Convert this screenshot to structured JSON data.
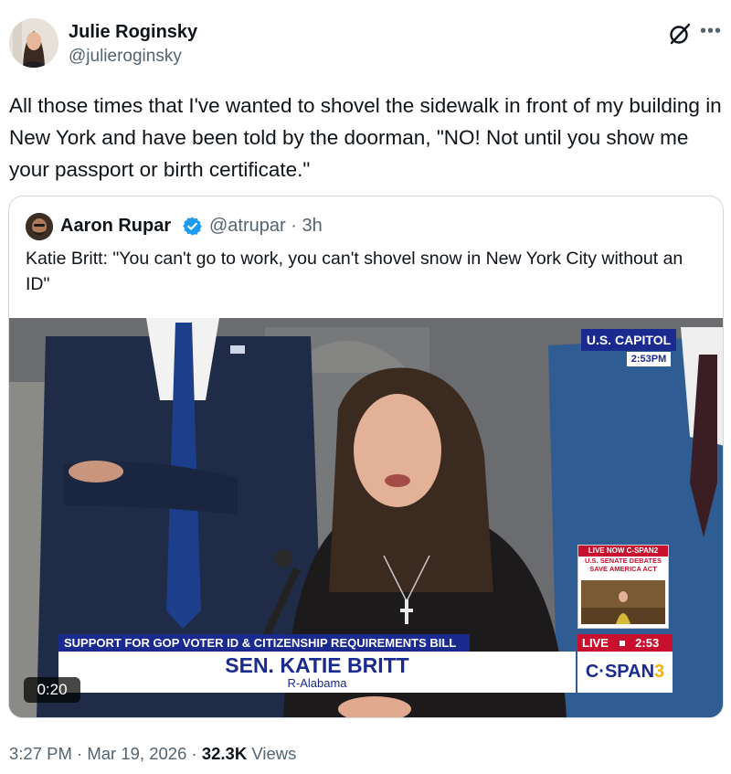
{
  "tweet": {
    "author_name": "Julie Roginsky",
    "author_handle": "@julieroginsky",
    "text": "All those times that I've wanted to shovel the sidewalk in front of my building in New York and have been told by the doorman, \"NO! Not until you show me your passport or birth certificate.\"",
    "time": "3:27 PM",
    "date": "Mar 19, 2026",
    "views_count": "32.3K",
    "views_label": "Views",
    "dot": "·"
  },
  "quoted": {
    "author_name": "Aaron Rupar",
    "author_handle": "@atrupar · 3h",
    "text": "Katie Britt: \"You can't go to work, you can't shovel snow in New York City without an ID\"",
    "video": {
      "duration": "0:20",
      "location_label": "U.S. CAPITOL",
      "location_time": "2:53PM",
      "banner": "SUPPORT FOR GOP VOTER ID & CITIZENSHIP REQUIREMENTS BILL",
      "speaker_name": "SEN. KATIE BRITT",
      "speaker_party": "R-Alabama",
      "inset_header": "LIVE NOW C-SPAN2",
      "inset_line1": "U.S. SENATE DEBATES",
      "inset_line2": "SAVE AMERICA ACT",
      "live_label": "LIVE",
      "live_time": "2:53",
      "network_text": "C·SPAN",
      "network_number": "3"
    }
  },
  "icons": {
    "grok": "grok-icon",
    "more": "more-icon",
    "verified": "verified-badge-icon"
  },
  "colors": {
    "verified_blue": "#1d9bf0",
    "cspan_blue": "#1b2a8e",
    "live_red": "#c8102e"
  }
}
